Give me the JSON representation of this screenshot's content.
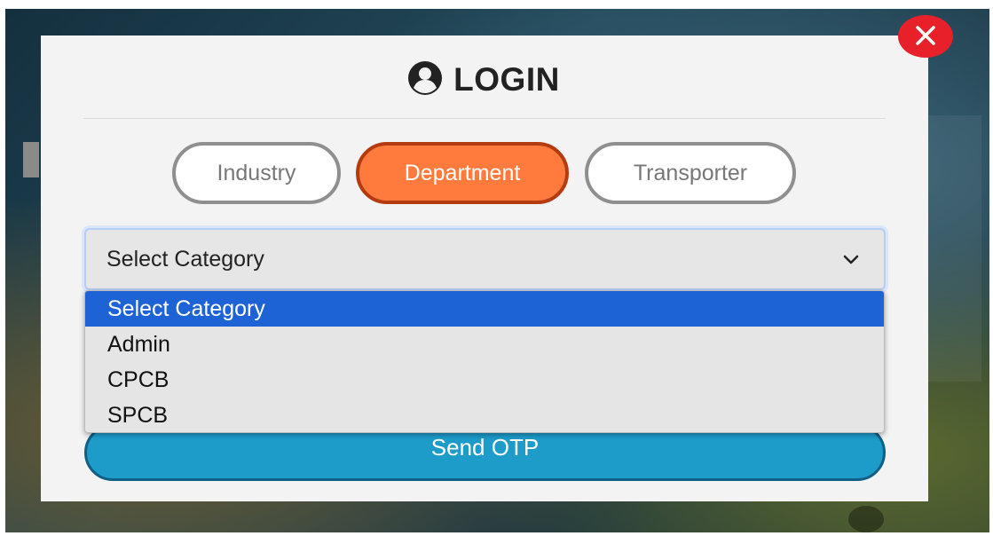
{
  "modal": {
    "title": "LOGIN",
    "icon": "user-circle-icon"
  },
  "close": {
    "icon": "close-icon",
    "color": "#e8202a"
  },
  "tabs": [
    {
      "label": "Industry",
      "active": false
    },
    {
      "label": "Department",
      "active": true
    },
    {
      "label": "Transporter",
      "active": false
    }
  ],
  "category_select": {
    "value": "Select Category",
    "icon": "chevron-down-icon",
    "options": [
      "Select Category",
      "Admin",
      "CPCB",
      "SPCB"
    ],
    "highlighted": "Select Category"
  },
  "send_otp": {
    "label": "Send OTP"
  },
  "colors": {
    "accent_active_tab": "#ff7a3d",
    "primary_button": "#1d9bc9",
    "option_highlight": "#1e63d6"
  }
}
